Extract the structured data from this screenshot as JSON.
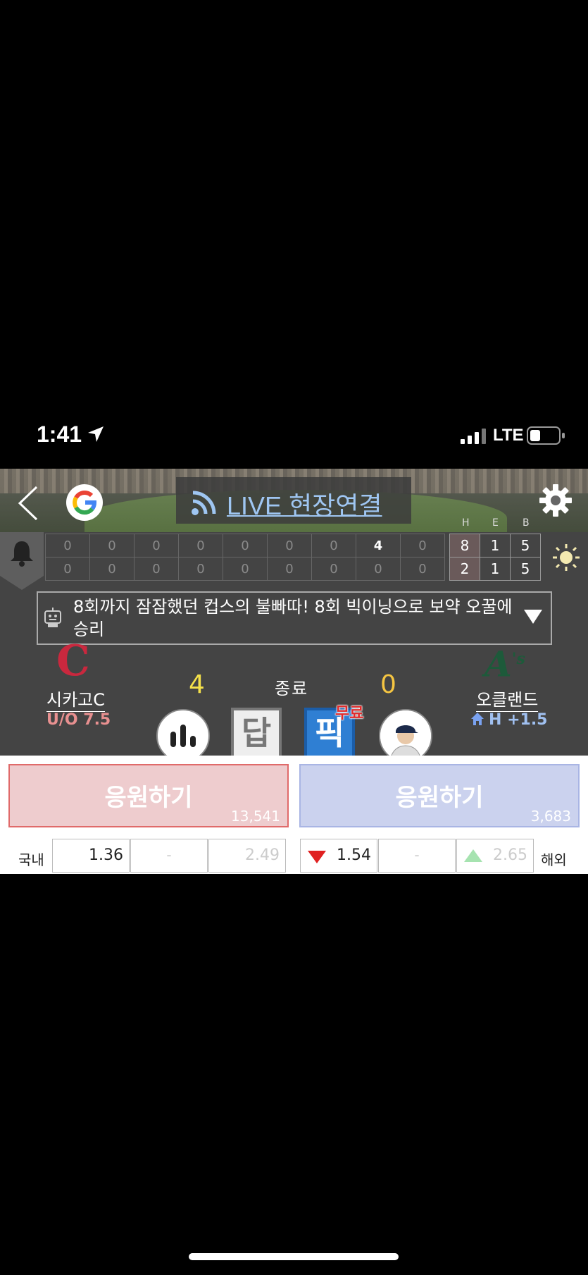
{
  "status_bar": {
    "time": "1:41",
    "network": "LTE"
  },
  "header": {
    "live_label": "LIVE 현장연결"
  },
  "innings": {
    "away": [
      "0",
      "0",
      "0",
      "0",
      "0",
      "0",
      "0",
      "4",
      "0"
    ],
    "home": [
      "0",
      "0",
      "0",
      "0",
      "0",
      "0",
      "0",
      "0",
      "0"
    ]
  },
  "heb": {
    "labels": [
      "H",
      "E",
      "B"
    ],
    "away": [
      "8",
      "1",
      "5"
    ],
    "home": [
      "2",
      "1",
      "5"
    ]
  },
  "ticker": {
    "text": "8회까지 잠잠했던 컵스의 불빠따! 8회 빅이닝으로 보약 오꿀에 승리"
  },
  "game": {
    "left_team": {
      "name": "시카고C",
      "line": "U/O 7.5",
      "score": "4",
      "logo": "C"
    },
    "right_team": {
      "name": "오클랜드",
      "line": "H +1.5",
      "score": "0",
      "logo": "A's"
    },
    "status": "종료"
  },
  "actions": {
    "answer_label": "답",
    "pick_label": "픽",
    "free_badge": "무료"
  },
  "cheer": {
    "left": {
      "label": "응원하기",
      "count": "13,541"
    },
    "right": {
      "label": "응원하기",
      "count": "3,683"
    }
  },
  "odds": {
    "domestic_label": "국내",
    "overseas_label": "해외",
    "domestic": [
      "1.36",
      "-",
      "2.49"
    ],
    "overseas": [
      "1.54",
      "-",
      "2.65"
    ]
  },
  "colors": {
    "cubs_red": "#c9283e",
    "athletics_green": "#1d5a3a",
    "score_yellow": "#f5e14a",
    "live_blue": "#9fc6f2",
    "odds_down": "#e02020",
    "odds_up": "#a6e3b0"
  }
}
